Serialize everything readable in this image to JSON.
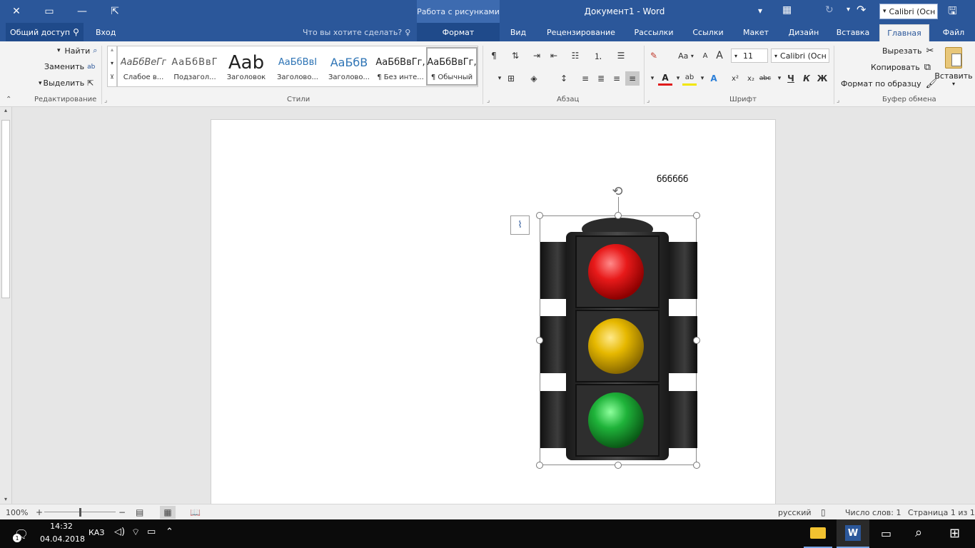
{
  "titlebar": {
    "doc_title": "Документ1 - Word",
    "contextual_tools": "Работа с рисунками",
    "font_quick": "Calibri (Осн",
    "close_glyph": "✕",
    "restore_glyph": "▭",
    "minimize_glyph": "—",
    "ribbon_display_glyph": "⇱"
  },
  "tabs": [
    "Файл",
    "Главная",
    "Вставка",
    "Дизайн",
    "Макет",
    "Ссылки",
    "Рассылки",
    "Рецензирование",
    "Вид",
    "Формат"
  ],
  "tell_me": "Что вы хотите сделать?",
  "signin": "Вход",
  "share": "Общий доступ",
  "clipboard": {
    "paste": "Вставить",
    "cut": "Вырезать",
    "copy": "Копировать",
    "format_painter": "Формат по образцу",
    "label": "Буфер обмена"
  },
  "font": {
    "name": "Calibri (Осн",
    "size": "11",
    "label": "Шрифт",
    "bold": "Ж",
    "italic": "К",
    "underline": "Ч",
    "strike": "abc",
    "sub": "x₂",
    "sup": "x²",
    "grow": "A",
    "shrink": "A",
    "case": "Aa",
    "color_a": "A"
  },
  "paragraph": {
    "label": "Абзац"
  },
  "styles": {
    "label": "Стили",
    "items": [
      {
        "preview": "АаБбВвГг,",
        "name": "¶ Обычный"
      },
      {
        "preview": "АаБбВвГг,",
        "name": "¶ Без инте..."
      },
      {
        "preview": "АаБбВ",
        "name": "Заголово..."
      },
      {
        "preview": "АаБбВвI",
        "name": "Заголово..."
      },
      {
        "preview": "Aab",
        "name": "Заголовок"
      },
      {
        "preview": "АаБбВвГ",
        "name": "Подзагол..."
      },
      {
        "preview": "АаБбВеГг",
        "name": "Слабое в..."
      }
    ]
  },
  "editing": {
    "find": "Найти",
    "replace": "Заменить",
    "select": "Выделить",
    "label": "Редактирование"
  },
  "document": {
    "text": "бббббб"
  },
  "status": {
    "page": "Страница 1 из 1",
    "words": "Число слов: 1",
    "language": "русский",
    "zoom": "100%",
    "zoom_fraction": 0.5
  },
  "taskbar": {
    "time": "14:32",
    "date": "04.04.2018",
    "lang": "КАЗ",
    "notifications": "1"
  },
  "colors": {
    "word_blue": "#2b579a",
    "red_light": "#e81a1a",
    "yellow_light": "#e6b800",
    "green_light": "#1fb33a"
  }
}
